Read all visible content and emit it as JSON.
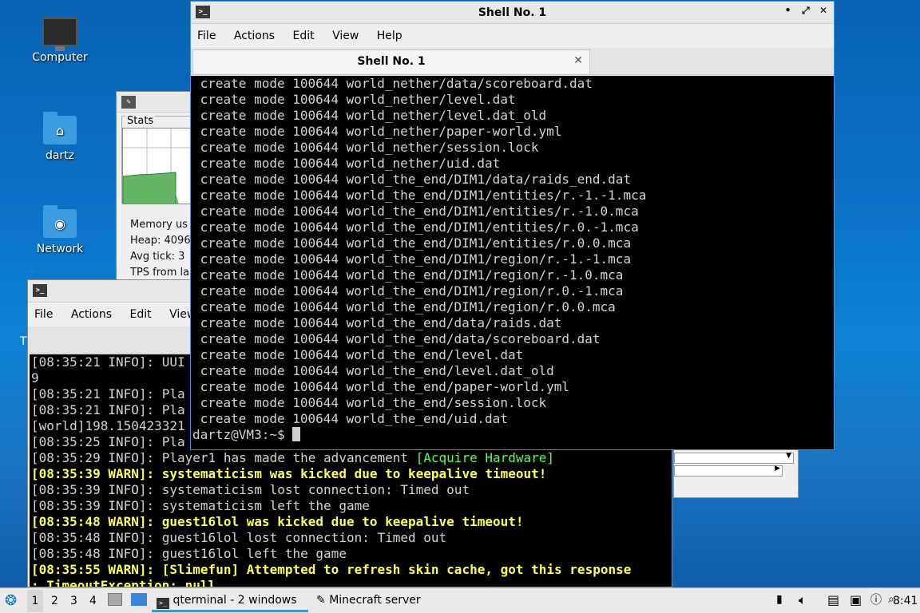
{
  "desktop": {
    "icons": [
      {
        "label": "Computer"
      },
      {
        "label": "dartz"
      },
      {
        "label": "Network"
      }
    ]
  },
  "stats_window": {
    "section_label": "Stats",
    "lines": [
      "Memory us",
      "Heap: 4096",
      "Avg tick: 3",
      "TPS from la"
    ]
  },
  "back_terminal": {
    "menu": [
      "File",
      "Actions",
      "Edit",
      "View"
    ],
    "lines": [
      {
        "text": "[08:35:21 INFO]: UUI",
        "style": "info"
      },
      {
        "text": "9",
        "style": "info"
      },
      {
        "text": "[08:35:21 INFO]: Pla",
        "style": "info"
      },
      {
        "text": "[08:35:21 INFO]: Pla",
        "style": "info"
      },
      {
        "text": "[world]198.150423321",
        "style": "info"
      },
      {
        "text": "[08:35:25 INFO]: Pla",
        "style": "info"
      },
      {
        "text": "[08:35:29 INFO]: Player1 has made the advancement ",
        "style": "info",
        "extra": "[Acquire Hardware]"
      },
      {
        "text": "[08:35:39 WARN]: systematicism was kicked due to keepalive timeout!",
        "style": "warn"
      },
      {
        "text": "[08:35:39 INFO]: systematicism lost connection: Timed out",
        "style": "info"
      },
      {
        "text": "[08:35:39 INFO]: systematicism left the game",
        "style": "info"
      },
      {
        "text": "[08:35:48 WARN]: guest16lol was kicked due to keepalive timeout!",
        "style": "warn"
      },
      {
        "text": "[08:35:48 INFO]: guest16lol lost connection: Timed out",
        "style": "info"
      },
      {
        "text": "[08:35:48 INFO]: guest16lol left the game",
        "style": "info"
      },
      {
        "text": "[08:35:55 WARN]: [Slimefun] Attempted to refresh skin cache, got this response",
        "style": "warn"
      },
      {
        "text": ": TimeoutException: null",
        "style": "warn"
      }
    ]
  },
  "shell_window": {
    "title": "Shell No. 1",
    "menu": [
      "File",
      "Actions",
      "Edit",
      "View",
      "Help"
    ],
    "tab_label": "Shell No. 1",
    "lines": [
      "create mode 100644 world_nether/data/scoreboard.dat",
      "create mode 100644 world_nether/level.dat",
      "create mode 100644 world_nether/level.dat_old",
      "create mode 100644 world_nether/paper-world.yml",
      "create mode 100644 world_nether/session.lock",
      "create mode 100644 world_nether/uid.dat",
      "create mode 100644 world_the_end/DIM1/data/raids_end.dat",
      "create mode 100644 world_the_end/DIM1/entities/r.-1.-1.mca",
      "create mode 100644 world_the_end/DIM1/entities/r.-1.0.mca",
      "create mode 100644 world_the_end/DIM1/entities/r.0.-1.mca",
      "create mode 100644 world_the_end/DIM1/entities/r.0.0.mca",
      "create mode 100644 world_the_end/DIM1/region/r.-1.-1.mca",
      "create mode 100644 world_the_end/DIM1/region/r.-1.0.mca",
      "create mode 100644 world_the_end/DIM1/region/r.0.-1.mca",
      "create mode 100644 world_the_end/DIM1/region/r.0.0.mca",
      "create mode 100644 world_the_end/data/raids.dat",
      "create mode 100644 world_the_end/data/scoreboard.dat",
      "create mode 100644 world_the_end/level.dat",
      "create mode 100644 world_the_end/level.dat_old",
      "create mode 100644 world_the_end/paper-world.yml",
      "create mode 100644 world_the_end/session.lock",
      "create mode 100644 world_the_end/uid.dat"
    ],
    "prompt": "dartz@VM3:~$ "
  },
  "taskbar": {
    "workspaces": [
      "1",
      "2",
      "3",
      "4"
    ],
    "tasks": [
      {
        "label": "qterminal - 2 windows"
      },
      {
        "label": "Minecraft server"
      }
    ],
    "clock": "8:41"
  }
}
